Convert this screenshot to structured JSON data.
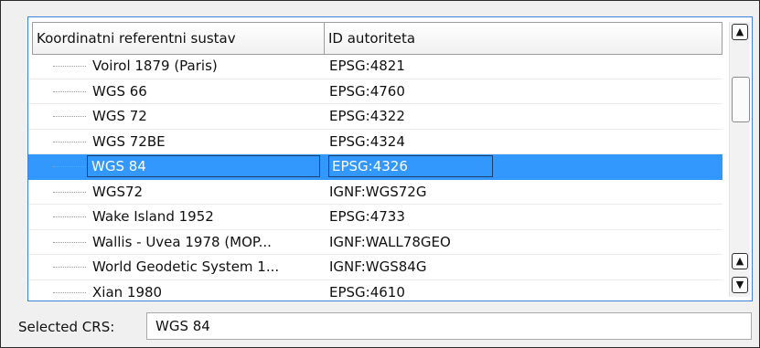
{
  "table": {
    "headers": [
      "Koordinatni referentni sustav",
      "ID autoriteta"
    ],
    "rows": [
      {
        "name": "Voirol 1879 (Paris)",
        "id": "EPSG:4821"
      },
      {
        "name": "WGS 66",
        "id": "EPSG:4760"
      },
      {
        "name": "WGS 72",
        "id": "EPSG:4322"
      },
      {
        "name": "WGS 72BE",
        "id": "EPSG:4324"
      },
      {
        "name": "WGS 84",
        "id": "EPSG:4326"
      },
      {
        "name": "WGS72",
        "id": "IGNF:WGS72G"
      },
      {
        "name": "Wake Island 1952",
        "id": "EPSG:4733"
      },
      {
        "name": "Wallis - Uvea 1978 (MOP...",
        "id": "IGNF:WALL78GEO"
      },
      {
        "name": "World Geodetic System 1...",
        "id": "IGNF:WGS84G"
      },
      {
        "name": "Xian 1980",
        "id": "EPSG:4610"
      }
    ],
    "selected_index": 4
  },
  "selected_crs": {
    "label": "Selected CRS:",
    "value": "WGS 84"
  },
  "colors": {
    "selection": "#3298fd",
    "focus_border": "#3f83d8"
  },
  "icons": {
    "scroll_up": "▲",
    "scroll_down": "▼"
  }
}
